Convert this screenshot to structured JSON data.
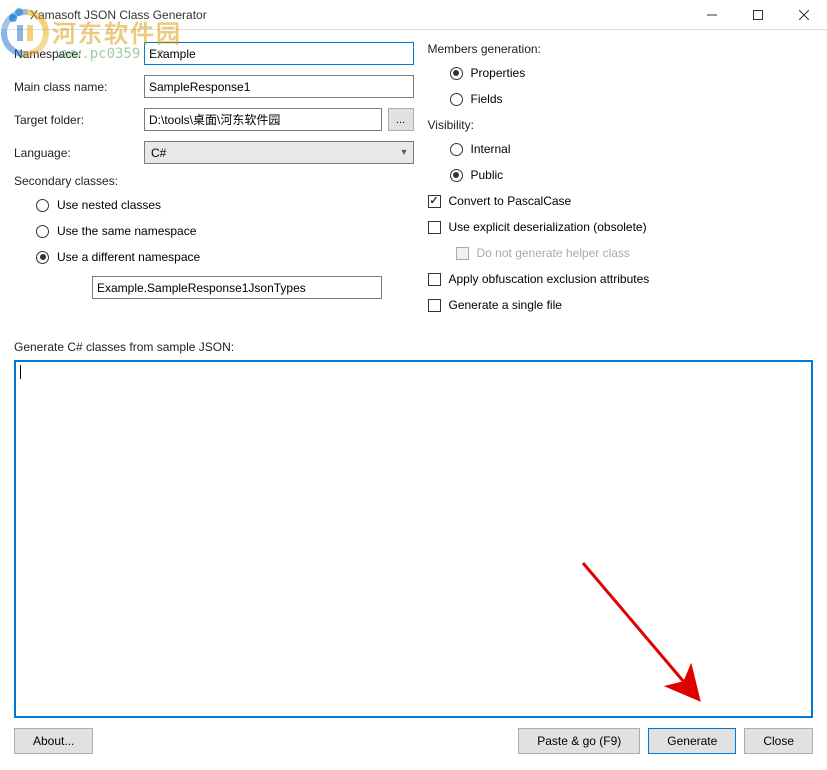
{
  "window": {
    "title": "Xamasoft JSON Class Generator"
  },
  "watermark": {
    "site_name": "河东软件园",
    "url": "www.pc0359.cn"
  },
  "form": {
    "namespace_label": "Namespace:",
    "namespace_value": "Example",
    "mainclass_label": "Main class name:",
    "mainclass_value": "SampleResponse1",
    "targetfolder_label": "Target folder:",
    "targetfolder_value": "D:\\tools\\桌面\\河东软件园",
    "browse_label": "...",
    "language_label": "Language:",
    "language_value": "C#"
  },
  "secondary": {
    "label": "Secondary classes:",
    "options": {
      "nested": "Use nested classes",
      "same_ns": "Use the same namespace",
      "diff_ns": "Use a different namespace"
    },
    "namespace_value": "Example.SampleResponse1JsonTypes"
  },
  "members": {
    "label": "Members generation:",
    "properties": "Properties",
    "fields": "Fields"
  },
  "visibility": {
    "label": "Visibility:",
    "internal": "Internal",
    "public": "Public"
  },
  "options": {
    "pascal": "Convert to PascalCase",
    "explicit": "Use explicit deserialization (obsolete)",
    "nohelper": "Do not generate helper class",
    "obfuscation": "Apply obfuscation exclusion attributes",
    "singlefile": "Generate a single file"
  },
  "json_section_label": "Generate C# classes from sample JSON:",
  "buttons": {
    "about": "About...",
    "paste": "Paste & go (F9)",
    "generate": "Generate",
    "close": "Close"
  }
}
